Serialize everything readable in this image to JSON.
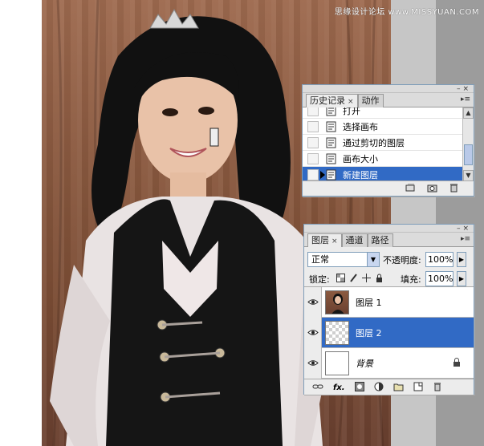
{
  "watermark": "思缘设计论坛 www.MISSYUAN.COM",
  "history_panel": {
    "tabs": [
      {
        "label": "历史记录",
        "active": true
      },
      {
        "label": "动作",
        "active": false
      }
    ],
    "items": [
      {
        "label": "打开",
        "selected": false
      },
      {
        "label": "选择画布",
        "selected": false
      },
      {
        "label": "通过剪切的图层",
        "selected": false
      },
      {
        "label": "画布大小",
        "selected": false
      },
      {
        "label": "新建图层",
        "selected": true
      }
    ],
    "icons": [
      "new-snapshot-icon",
      "camera-icon",
      "trash-icon"
    ]
  },
  "layers_panel": {
    "tabs": [
      {
        "label": "图层",
        "active": true
      },
      {
        "label": "通道",
        "active": false
      },
      {
        "label": "路径",
        "active": false
      }
    ],
    "blend_mode": "正常",
    "opacity_label": "不透明度:",
    "opacity_value": "100%",
    "lock_label": "锁定:",
    "fill_label": "填充:",
    "fill_value": "100%",
    "layers": [
      {
        "name": "图层 1",
        "visible": true,
        "selected": false,
        "thumb": "photo"
      },
      {
        "name": "图层 2",
        "visible": true,
        "selected": true,
        "thumb": "transparent"
      },
      {
        "name": "背景",
        "visible": true,
        "selected": false,
        "thumb": "white",
        "locked": true
      }
    ],
    "footer_icons": [
      "link-icon",
      "fx-icon",
      "mask-icon",
      "adjustment-icon",
      "folder-icon",
      "new-layer-icon",
      "trash-icon"
    ],
    "fx_label": "fx."
  },
  "colors": {
    "selection": "#316ac5",
    "panel_bg": "#ececec",
    "panel_border": "#7f9db9"
  }
}
